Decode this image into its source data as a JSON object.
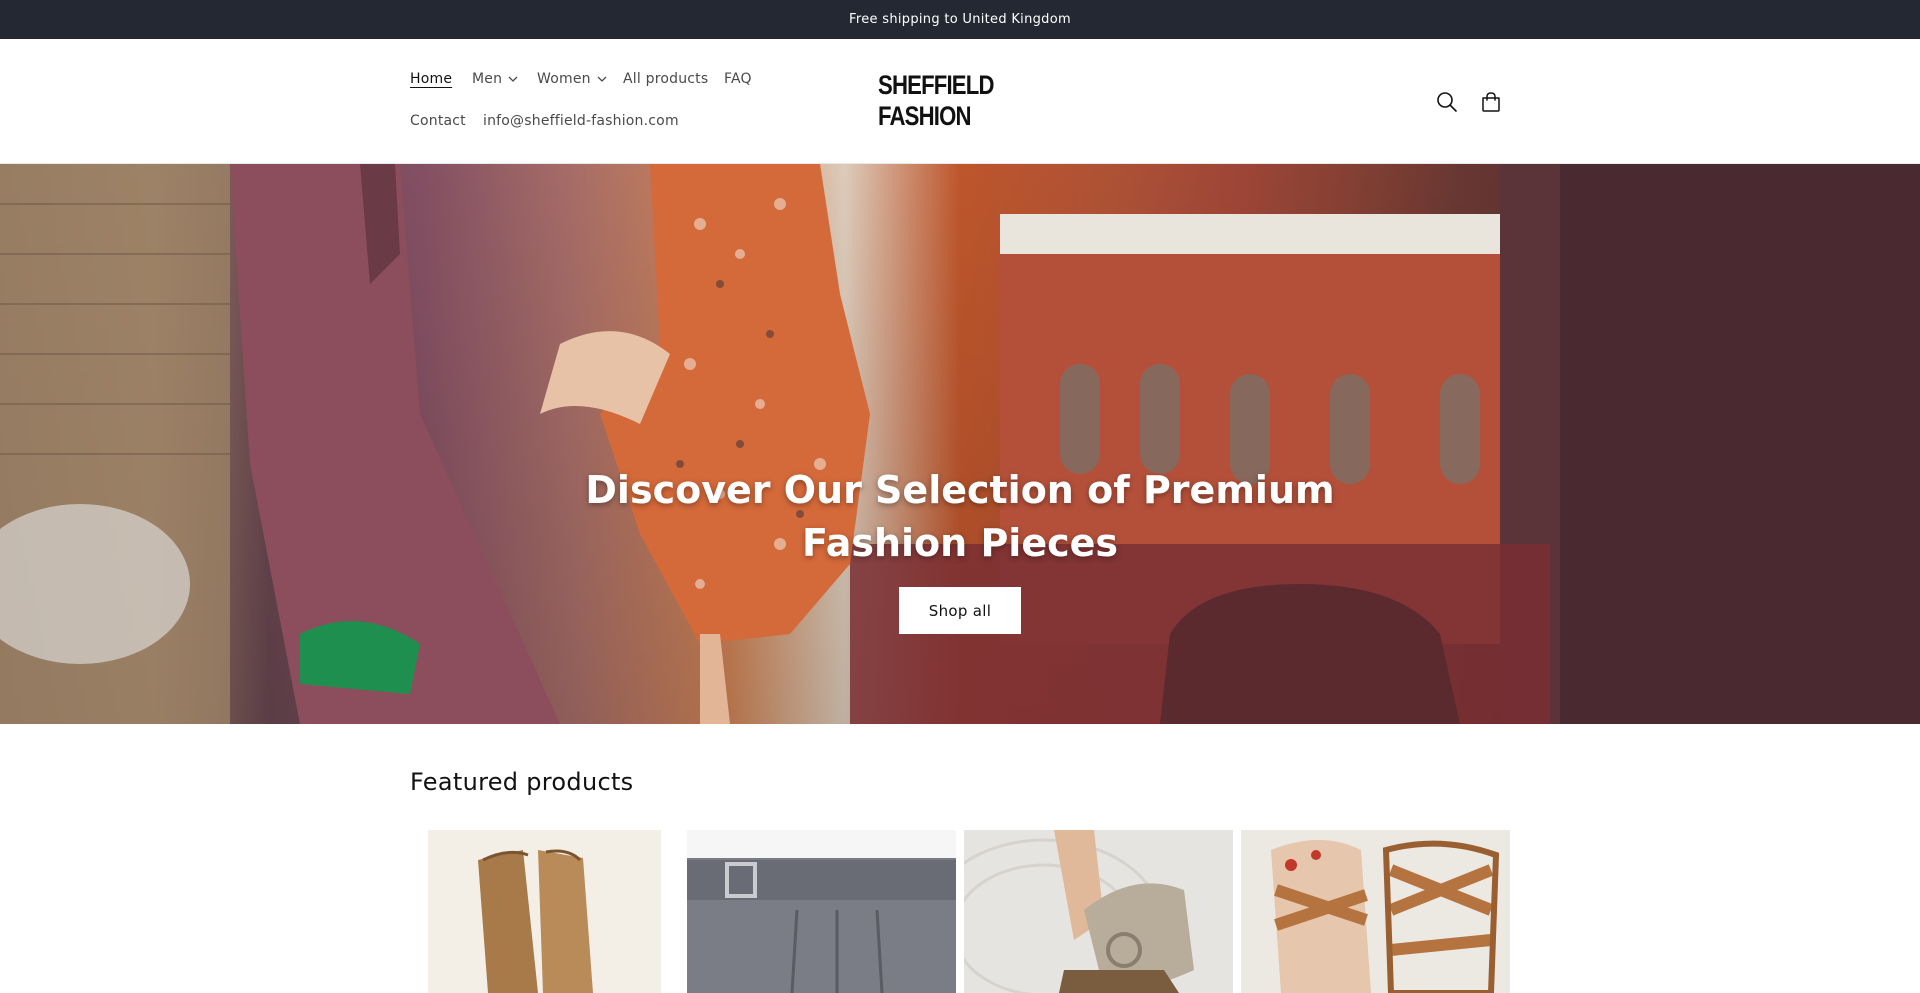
{
  "announcement": {
    "text": "Free shipping to United Kingdom"
  },
  "header": {
    "logo": "SHEFFIELD FASHION",
    "nav": [
      {
        "label": "Home",
        "active": true
      },
      {
        "label": "Men",
        "has_dropdown": true
      },
      {
        "label": "Women",
        "has_dropdown": true
      },
      {
        "label": "All products"
      },
      {
        "label": "FAQ"
      },
      {
        "label": "Contact"
      },
      {
        "label": "info@sheffield-fashion.com"
      }
    ],
    "icons": [
      "search-icon",
      "cart-icon"
    ]
  },
  "hero": {
    "title": "Discover Our Selection of Premium Fashion Pieces",
    "button_label": "Shop all"
  },
  "featured": {
    "title": "Featured products",
    "products": [
      {
        "image": "brown-leather-boots"
      },
      {
        "image": "grey-pleated-skirt"
      },
      {
        "image": "beige-slide-sandals"
      },
      {
        "image": "tan-strappy-sandals"
      }
    ]
  },
  "colors": {
    "announcement_bg": "#242833",
    "text": "#121212",
    "button_bg": "#ffffff"
  }
}
